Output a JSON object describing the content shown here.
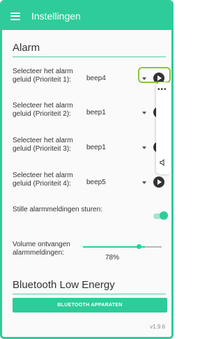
{
  "appbar": {
    "title": "Instellingen"
  },
  "alarm_section": {
    "title": "Alarm"
  },
  "alarm_rows": [
    {
      "label": "Selecteer het alarm geluid (Prioriteit 1):",
      "value": "beep4"
    },
    {
      "label": "Selecteer het alarm geluid (Prioriteit 2):",
      "value": "beep1"
    },
    {
      "label": "Selecteer het alarm geluid (Prioriteit 3):",
      "value": "beep1"
    },
    {
      "label": "Selecteer het alarm geluid (Prioriteit 4):",
      "value": "beep5"
    }
  ],
  "silent_alarms": {
    "label": "Stille alarmmeldingen sturen:",
    "enabled": true
  },
  "volume": {
    "label": "Volume ontvangen alarmmeldingen:",
    "value": "78%",
    "level_percent": 78
  },
  "bluetooth_section": {
    "title": "Bluetooth Low Energy",
    "button_label": "BLUETOOTH APPARATEN"
  },
  "side_panel": {
    "menu_glyph": "•••",
    "speaker_icon": "speaker-icon"
  },
  "footer": {
    "version": "v1.9.6"
  },
  "colors": {
    "accent": "#2ecc9a",
    "highlight": "#8cc43f",
    "play": "#333333"
  }
}
